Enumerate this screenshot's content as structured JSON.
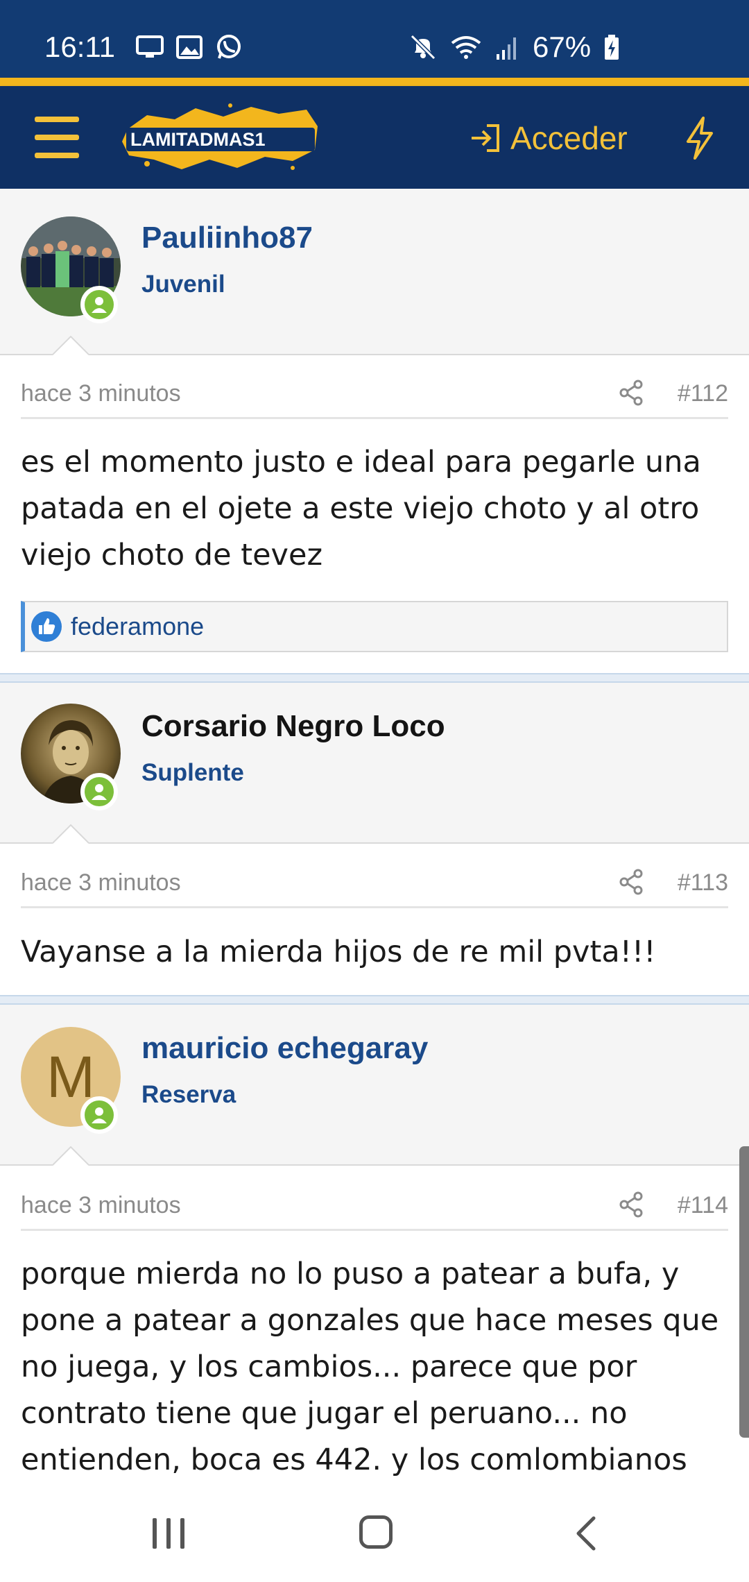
{
  "status_bar": {
    "time": "16:11",
    "battery_text": "67%",
    "icons_left": [
      "screen-cast-icon",
      "gallery-icon",
      "whatsapp-icon"
    ],
    "icons_right": [
      "mute-icon",
      "wifi-icon",
      "signal-icon",
      "battery-charging-icon"
    ]
  },
  "header": {
    "logo_text": "LAMITADMAS1",
    "login_label": "Acceder",
    "menu_icon": "hamburger-icon",
    "login_icon": "login-arrow-icon",
    "bolt_icon": "lightning-icon"
  },
  "colors": {
    "brand_blue": "#0f3064",
    "brand_gold": "#f3b61d",
    "link_blue": "#1b4a8a",
    "online_green": "#7cbf3a"
  },
  "posts": [
    {
      "username": "Pauliinho87",
      "rank": "Juvenil",
      "time": "hace 3 minutos",
      "number": "#112",
      "body": "es el momento justo e ideal para pegarle una patada en el ojete a este viejo choto y al otro viejo choto de tevez",
      "reaction_user": "federamone"
    },
    {
      "username": "Corsario Negro Loco",
      "rank": "Suplente",
      "time": "hace 3 minutos",
      "number": "#113",
      "body": "Vayanse a la mierda hijos de re mil pvta!!!"
    },
    {
      "username": "mauricio echegaray",
      "rank": "Reserva",
      "avatar_letter": "M",
      "time": "hace 3 minutos",
      "number": "#114",
      "body": "porque mierda no lo puso a patear a bufa, y pone a patear a gonzales que hace meses que no juega, y los cambios... parece que por contrato tiene que jugar el peruano... no entienden, boca es 442. y los comlombianos"
    }
  ]
}
